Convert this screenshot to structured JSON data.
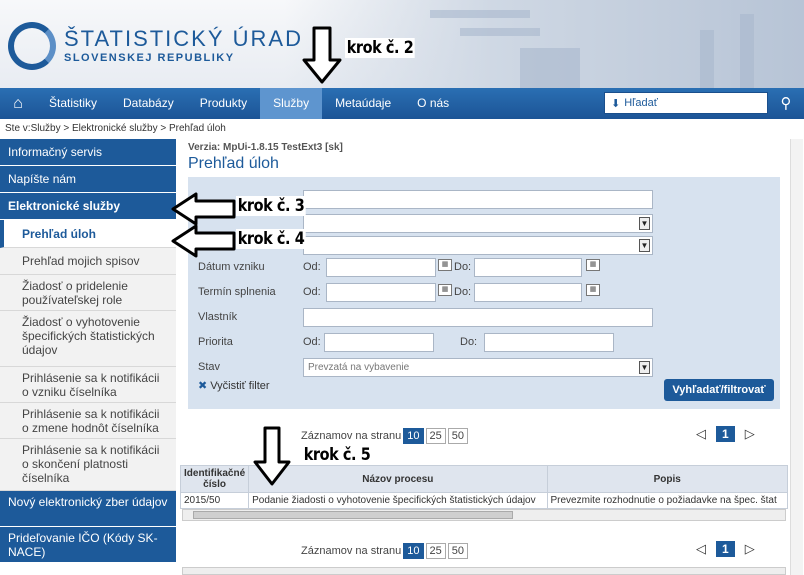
{
  "header": {
    "title": "ŠTATISTICKÝ ÚRAD",
    "subtitle": "SLOVENSKEJ REPUBLIKY"
  },
  "nav": {
    "home_icon": "home-icon",
    "items": [
      "Štatistiky",
      "Databázy",
      "Produkty",
      "Služby",
      "Metaúdaje",
      "O nás"
    ],
    "active": "Služby",
    "search_placeholder": "Hľadať"
  },
  "breadcrumb": "Ste v:Služby > Elektronické služby > Prehľad úloh",
  "sidebar": [
    {
      "label": "Informačný servis",
      "style": "dark"
    },
    {
      "label": "Napíšte nám",
      "style": "dark"
    },
    {
      "label": "Elektronické služby",
      "style": "dark-bold"
    },
    {
      "label": "Prehľad úloh",
      "style": "active"
    },
    {
      "label": "Prehľad mojich spisov",
      "style": "light"
    },
    {
      "label": "Žiadosť o pridelenie používateľskej role",
      "style": "light"
    },
    {
      "label": "Žiadosť o vyhotovenie špecifických štatistických údajov",
      "style": "light"
    },
    {
      "label": "Prihlásenie sa k notifikácii o vzniku číselníka",
      "style": "light"
    },
    {
      "label": "Prihlásenie sa k notifikácii o zmene hodnôt číselníka",
      "style": "light"
    },
    {
      "label": "Prihlásenie sa k notifikácii o skončení platnosti číselníka",
      "style": "light"
    },
    {
      "label": "Nový elektronický zber údajov",
      "style": "dark"
    },
    {
      "label": "Prideľovanie IČO (Kódy SK-NACE)",
      "style": "dark"
    }
  ],
  "main": {
    "version": "Verzia: MpUi-1.8.15 TestExt3 [sk]",
    "title": "Prehľad úloh",
    "filter": {
      "datum_vzniku": "Dátum vzniku",
      "termin_splnenia": "Termín splnenia",
      "vlastnik": "Vlastník",
      "priorita": "Priorita",
      "stav": "Stav",
      "od": "Od:",
      "do": "Do:",
      "stav_value": "Prevzatá na vybavenie",
      "clear": "Vyčistiť filter",
      "submit": "Vyhľadať/filtrovať"
    },
    "pager": {
      "label": "Záznamov na stranu",
      "sizes": [
        "10",
        "25",
        "50"
      ],
      "selected": "10",
      "page": "1",
      "prev": "◁",
      "next": "▷"
    },
    "table": {
      "headers": [
        "Identifikačné číslo",
        "Názov procesu",
        "Popis"
      ],
      "row": [
        "2015/50",
        "Podanie žiadosti o vyhotovenie špecifických štatistických údajov",
        "Prevezmite rozhodnutie o požiadavke na špec. štat"
      ]
    }
  },
  "annotations": {
    "krok2": "krok č. 2",
    "krok3": "krok č. 3",
    "krok4": "krok č. 4",
    "krok5": "krok č. 5"
  }
}
